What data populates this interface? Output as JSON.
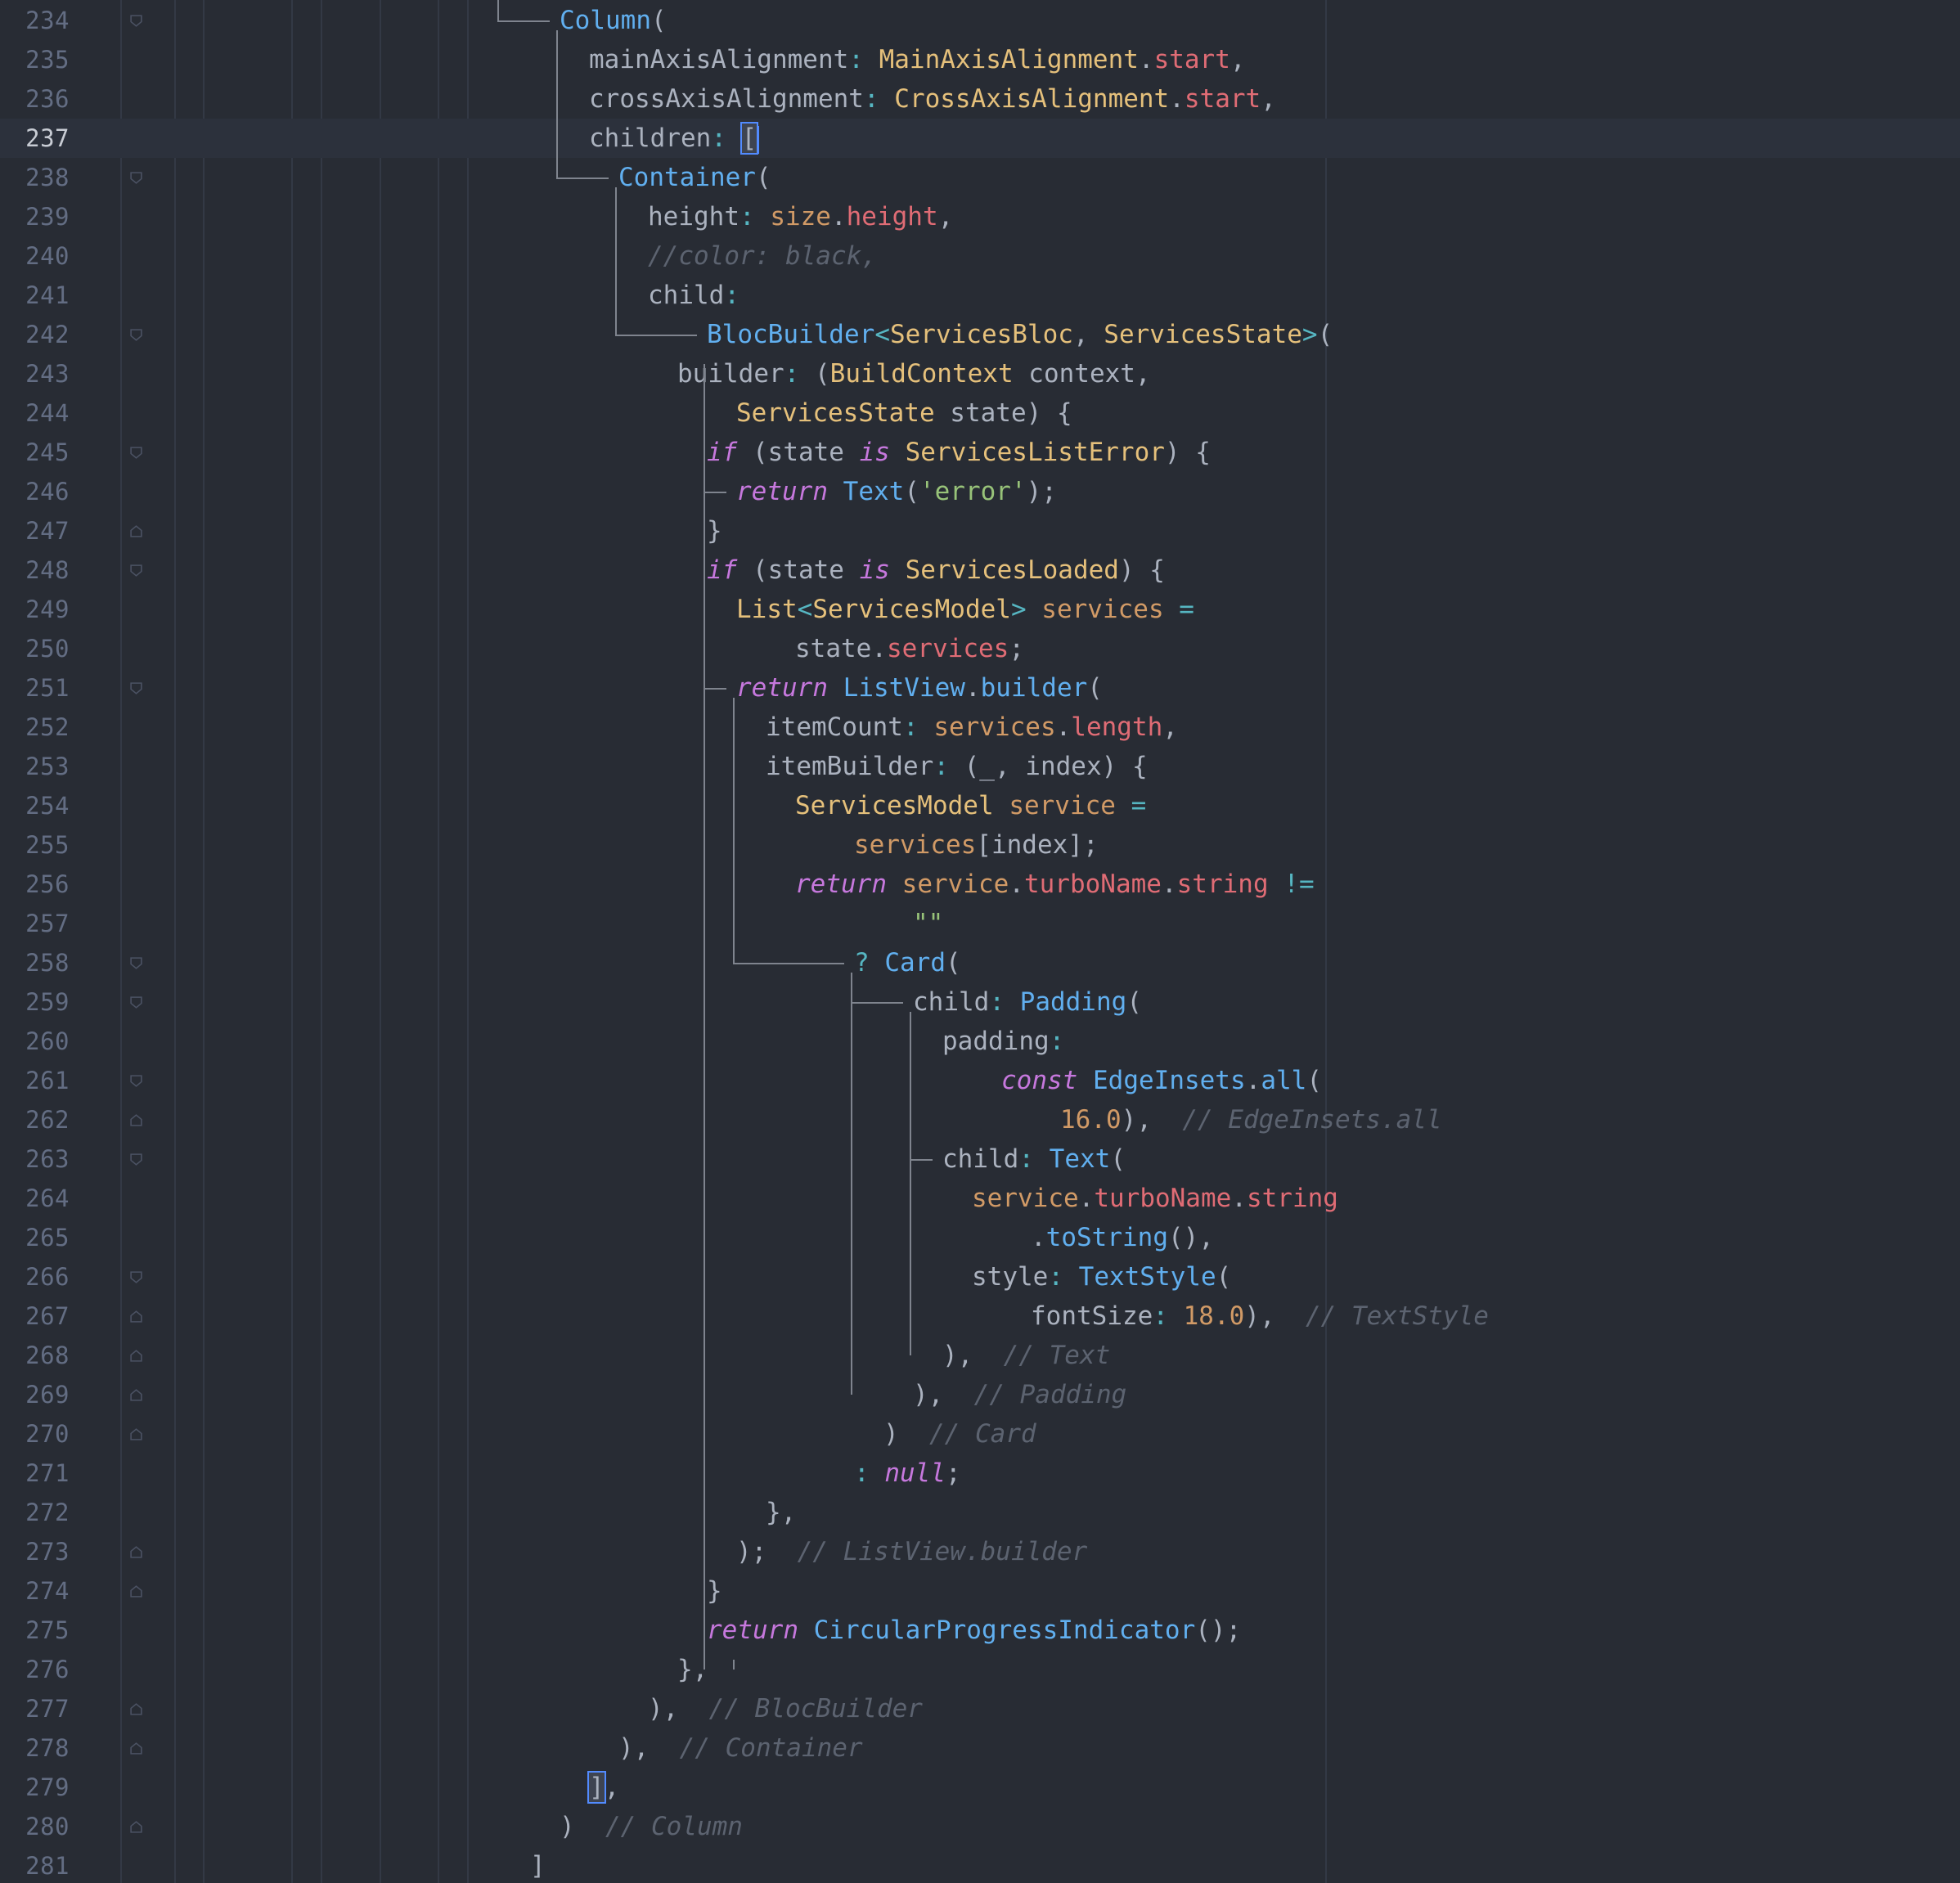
{
  "editor": {
    "current_line": 237,
    "lines": [
      {
        "number": "234",
        "indent": 0,
        "tokens": [
          {
            "t": "Column",
            "c": "func"
          },
          {
            "t": "(",
            "c": "plain"
          }
        ]
      },
      {
        "number": "235",
        "indent": 1,
        "tokens": [
          {
            "t": "mainAxisAlignment",
            "c": "plain"
          },
          {
            "t": ": ",
            "c": "op"
          },
          {
            "t": "MainAxisAlignment",
            "c": "class"
          },
          {
            "t": ".",
            "c": "plain"
          },
          {
            "t": "start",
            "c": "prop"
          },
          {
            "t": ",",
            "c": "plain"
          }
        ]
      },
      {
        "number": "236",
        "indent": 1,
        "tokens": [
          {
            "t": "crossAxisAlignment",
            "c": "plain"
          },
          {
            "t": ": ",
            "c": "op"
          },
          {
            "t": "CrossAxisAlignment",
            "c": "class"
          },
          {
            "t": ".",
            "c": "plain"
          },
          {
            "t": "start",
            "c": "prop"
          },
          {
            "t": ",",
            "c": "plain"
          }
        ]
      },
      {
        "number": "237",
        "indent": 1,
        "tokens": [
          {
            "t": "children",
            "c": "plain"
          },
          {
            "t": ": ",
            "c": "op"
          },
          {
            "t": "[",
            "c": "bracket"
          },
          {
            "t": "",
            "c": "caret"
          }
        ]
      },
      {
        "number": "238",
        "indent": 2,
        "tokens": [
          {
            "t": "Container",
            "c": "func"
          },
          {
            "t": "(",
            "c": "plain"
          }
        ]
      },
      {
        "number": "239",
        "indent": 3,
        "tokens": [
          {
            "t": "height",
            "c": "plain"
          },
          {
            "t": ": ",
            "c": "op"
          },
          {
            "t": "size",
            "c": "var"
          },
          {
            "t": ".",
            "c": "plain"
          },
          {
            "t": "height",
            "c": "prop"
          },
          {
            "t": ",",
            "c": "plain"
          }
        ]
      },
      {
        "number": "240",
        "indent": 3,
        "tokens": [
          {
            "t": "//color: black,",
            "c": "comment"
          }
        ]
      },
      {
        "number": "241",
        "indent": 3,
        "tokens": [
          {
            "t": "child",
            "c": "plain"
          },
          {
            "t": ":",
            "c": "op"
          }
        ]
      },
      {
        "number": "242",
        "indent": 5,
        "tokens": [
          {
            "t": "BlocBuilder",
            "c": "func"
          },
          {
            "t": "<",
            "c": "op"
          },
          {
            "t": "ServicesBloc",
            "c": "class"
          },
          {
            "t": ", ",
            "c": "plain"
          },
          {
            "t": "ServicesState",
            "c": "class"
          },
          {
            "t": ">",
            "c": "op"
          },
          {
            "t": "(",
            "c": "plain"
          }
        ]
      },
      {
        "number": "243",
        "indent": 4,
        "tokens": [
          {
            "t": "builder",
            "c": "plain"
          },
          {
            "t": ": ",
            "c": "op"
          },
          {
            "t": "(",
            "c": "plain"
          },
          {
            "t": "BuildContext",
            "c": "class"
          },
          {
            "t": " context,",
            "c": "plain"
          }
        ]
      },
      {
        "number": "244",
        "indent": 6,
        "tokens": [
          {
            "t": "ServicesState",
            "c": "class"
          },
          {
            "t": " state) {",
            "c": "plain"
          }
        ]
      },
      {
        "number": "245",
        "indent": 5,
        "tokens": [
          {
            "t": "if",
            "c": "kw"
          },
          {
            "t": " (state ",
            "c": "plain"
          },
          {
            "t": "is",
            "c": "kw"
          },
          {
            "t": " ",
            "c": "plain"
          },
          {
            "t": "ServicesListError",
            "c": "class"
          },
          {
            "t": ") {",
            "c": "plain"
          }
        ]
      },
      {
        "number": "246",
        "indent": 6,
        "tokens": [
          {
            "t": "return",
            "c": "kw"
          },
          {
            "t": " ",
            "c": "plain"
          },
          {
            "t": "Text",
            "c": "func"
          },
          {
            "t": "(",
            "c": "plain"
          },
          {
            "t": "'error'",
            "c": "str"
          },
          {
            "t": ");",
            "c": "plain"
          }
        ]
      },
      {
        "number": "247",
        "indent": 5,
        "tokens": [
          {
            "t": "}",
            "c": "plain"
          }
        ]
      },
      {
        "number": "248",
        "indent": 5,
        "tokens": [
          {
            "t": "if",
            "c": "kw"
          },
          {
            "t": " (state ",
            "c": "plain"
          },
          {
            "t": "is",
            "c": "kw"
          },
          {
            "t": " ",
            "c": "plain"
          },
          {
            "t": "ServicesLoaded",
            "c": "class"
          },
          {
            "t": ") {",
            "c": "plain"
          }
        ]
      },
      {
        "number": "249",
        "indent": 6,
        "tokens": [
          {
            "t": "List",
            "c": "class"
          },
          {
            "t": "<",
            "c": "op"
          },
          {
            "t": "ServicesModel",
            "c": "class"
          },
          {
            "t": "> ",
            "c": "op"
          },
          {
            "t": "services",
            "c": "var"
          },
          {
            "t": " =",
            "c": "op"
          }
        ]
      },
      {
        "number": "250",
        "indent": 8,
        "tokens": [
          {
            "t": "state",
            "c": "plain"
          },
          {
            "t": ".",
            "c": "plain"
          },
          {
            "t": "services",
            "c": "prop"
          },
          {
            "t": ";",
            "c": "plain"
          }
        ]
      },
      {
        "number": "251",
        "indent": 6,
        "tokens": [
          {
            "t": "return",
            "c": "kw"
          },
          {
            "t": " ",
            "c": "plain"
          },
          {
            "t": "ListView",
            "c": "func"
          },
          {
            "t": ".",
            "c": "plain"
          },
          {
            "t": "builder",
            "c": "func"
          },
          {
            "t": "(",
            "c": "plain"
          }
        ]
      },
      {
        "number": "252",
        "indent": 7,
        "tokens": [
          {
            "t": "itemCount",
            "c": "plain"
          },
          {
            "t": ": ",
            "c": "op"
          },
          {
            "t": "services",
            "c": "var"
          },
          {
            "t": ".",
            "c": "plain"
          },
          {
            "t": "length",
            "c": "prop"
          },
          {
            "t": ",",
            "c": "plain"
          }
        ]
      },
      {
        "number": "253",
        "indent": 7,
        "tokens": [
          {
            "t": "itemBuilder",
            "c": "plain"
          },
          {
            "t": ": ",
            "c": "op"
          },
          {
            "t": "(_, index) {",
            "c": "plain"
          }
        ]
      },
      {
        "number": "254",
        "indent": 8,
        "tokens": [
          {
            "t": "ServicesModel",
            "c": "class"
          },
          {
            "t": " ",
            "c": "plain"
          },
          {
            "t": "service",
            "c": "var"
          },
          {
            "t": " =",
            "c": "op"
          }
        ]
      },
      {
        "number": "255",
        "indent": 10,
        "tokens": [
          {
            "t": "services",
            "c": "var"
          },
          {
            "t": "[index];",
            "c": "plain"
          }
        ]
      },
      {
        "number": "256",
        "indent": 8,
        "tokens": [
          {
            "t": "return",
            "c": "kw"
          },
          {
            "t": " ",
            "c": "plain"
          },
          {
            "t": "service",
            "c": "var"
          },
          {
            "t": ".",
            "c": "plain"
          },
          {
            "t": "turboName",
            "c": "prop"
          },
          {
            "t": ".",
            "c": "plain"
          },
          {
            "t": "string",
            "c": "prop"
          },
          {
            "t": " !=",
            "c": "op"
          }
        ]
      },
      {
        "number": "257",
        "indent": 12,
        "tokens": [
          {
            "t": "\"\"",
            "c": "str"
          }
        ]
      },
      {
        "number": "258",
        "indent": 10,
        "tokens": [
          {
            "t": "? ",
            "c": "op"
          },
          {
            "t": "Card",
            "c": "func"
          },
          {
            "t": "(",
            "c": "plain"
          }
        ]
      },
      {
        "number": "259",
        "indent": 12,
        "tokens": [
          {
            "t": "child",
            "c": "plain"
          },
          {
            "t": ": ",
            "c": "op"
          },
          {
            "t": "Padding",
            "c": "func"
          },
          {
            "t": "(",
            "c": "plain"
          }
        ]
      },
      {
        "number": "260",
        "indent": 13,
        "tokens": [
          {
            "t": "padding",
            "c": "plain"
          },
          {
            "t": ":",
            "c": "op"
          }
        ]
      },
      {
        "number": "261",
        "indent": 15,
        "tokens": [
          {
            "t": "const",
            "c": "kw"
          },
          {
            "t": " ",
            "c": "plain"
          },
          {
            "t": "EdgeInsets",
            "c": "func"
          },
          {
            "t": ".",
            "c": "plain"
          },
          {
            "t": "all",
            "c": "func"
          },
          {
            "t": "(",
            "c": "plain"
          }
        ]
      },
      {
        "number": "262",
        "indent": 17,
        "tokens": [
          {
            "t": "16.0",
            "c": "num"
          },
          {
            "t": "),  ",
            "c": "plain"
          },
          {
            "t": "// EdgeInsets.all",
            "c": "comment"
          }
        ]
      },
      {
        "number": "263",
        "indent": 13,
        "tokens": [
          {
            "t": "child",
            "c": "plain"
          },
          {
            "t": ": ",
            "c": "op"
          },
          {
            "t": "Text",
            "c": "func"
          },
          {
            "t": "(",
            "c": "plain"
          }
        ]
      },
      {
        "number": "264",
        "indent": 14,
        "tokens": [
          {
            "t": "service",
            "c": "var"
          },
          {
            "t": ".",
            "c": "plain"
          },
          {
            "t": "turboName",
            "c": "prop"
          },
          {
            "t": ".",
            "c": "plain"
          },
          {
            "t": "string",
            "c": "prop"
          }
        ]
      },
      {
        "number": "265",
        "indent": 16,
        "tokens": [
          {
            "t": ".",
            "c": "plain"
          },
          {
            "t": "toString",
            "c": "func"
          },
          {
            "t": "(),",
            "c": "plain"
          }
        ]
      },
      {
        "number": "266",
        "indent": 14,
        "tokens": [
          {
            "t": "style",
            "c": "plain"
          },
          {
            "t": ": ",
            "c": "op"
          },
          {
            "t": "TextStyle",
            "c": "func"
          },
          {
            "t": "(",
            "c": "plain"
          }
        ]
      },
      {
        "number": "267",
        "indent": 16,
        "tokens": [
          {
            "t": "fontSize",
            "c": "plain"
          },
          {
            "t": ": ",
            "c": "op"
          },
          {
            "t": "18.0",
            "c": "num"
          },
          {
            "t": "),  ",
            "c": "plain"
          },
          {
            "t": "// TextStyle",
            "c": "comment"
          }
        ]
      },
      {
        "number": "268",
        "indent": 13,
        "tokens": [
          {
            "t": "),  ",
            "c": "plain"
          },
          {
            "t": "// Text",
            "c": "comment"
          }
        ]
      },
      {
        "number": "269",
        "indent": 12,
        "tokens": [
          {
            "t": "),  ",
            "c": "plain"
          },
          {
            "t": "// Padding",
            "c": "comment"
          }
        ]
      },
      {
        "number": "270",
        "indent": 11,
        "tokens": [
          {
            "t": ")  ",
            "c": "plain"
          },
          {
            "t": "// Card",
            "c": "comment"
          }
        ]
      },
      {
        "number": "271",
        "indent": 10,
        "tokens": [
          {
            "t": ": ",
            "c": "op"
          },
          {
            "t": "null",
            "c": "kw"
          },
          {
            "t": ";",
            "c": "plain"
          }
        ]
      },
      {
        "number": "272",
        "indent": 7,
        "tokens": [
          {
            "t": "},",
            "c": "plain"
          }
        ]
      },
      {
        "number": "273",
        "indent": 6,
        "tokens": [
          {
            "t": ");  ",
            "c": "plain"
          },
          {
            "t": "// ListView.builder",
            "c": "comment"
          }
        ]
      },
      {
        "number": "274",
        "indent": 5,
        "tokens": [
          {
            "t": "}",
            "c": "plain"
          }
        ]
      },
      {
        "number": "275",
        "indent": 5,
        "tokens": [
          {
            "t": "return",
            "c": "kw"
          },
          {
            "t": " ",
            "c": "plain"
          },
          {
            "t": "CircularProgressIndicator",
            "c": "func"
          },
          {
            "t": "();",
            "c": "plain"
          }
        ]
      },
      {
        "number": "276",
        "indent": 4,
        "tokens": [
          {
            "t": "},",
            "c": "plain"
          }
        ]
      },
      {
        "number": "277",
        "indent": 3,
        "tokens": [
          {
            "t": "),  ",
            "c": "plain"
          },
          {
            "t": "// BlocBuilder",
            "c": "comment"
          }
        ]
      },
      {
        "number": "278",
        "indent": 2,
        "tokens": [
          {
            "t": "),  ",
            "c": "plain"
          },
          {
            "t": "// Container",
            "c": "comment"
          }
        ]
      },
      {
        "number": "279",
        "indent": 1,
        "tokens": [
          {
            "t": "]",
            "c": "bracket"
          },
          {
            "t": ",",
            "c": "plain"
          }
        ]
      },
      {
        "number": "280",
        "indent": 0,
        "tokens": [
          {
            "t": ")  ",
            "c": "plain"
          },
          {
            "t": "// Column",
            "c": "comment"
          }
        ]
      },
      {
        "number": "281",
        "indent": -1,
        "tokens": [
          {
            "t": "]",
            "c": "plain"
          }
        ]
      }
    ],
    "fold_open_lines": [
      "234",
      "238",
      "242",
      "245",
      "248",
      "251",
      "258",
      "259",
      "261",
      "263",
      "266"
    ],
    "fold_close_lines": [
      "247",
      "262",
      "267",
      "268",
      "269",
      "270",
      "273",
      "274",
      "277",
      "278",
      "280"
    ]
  }
}
